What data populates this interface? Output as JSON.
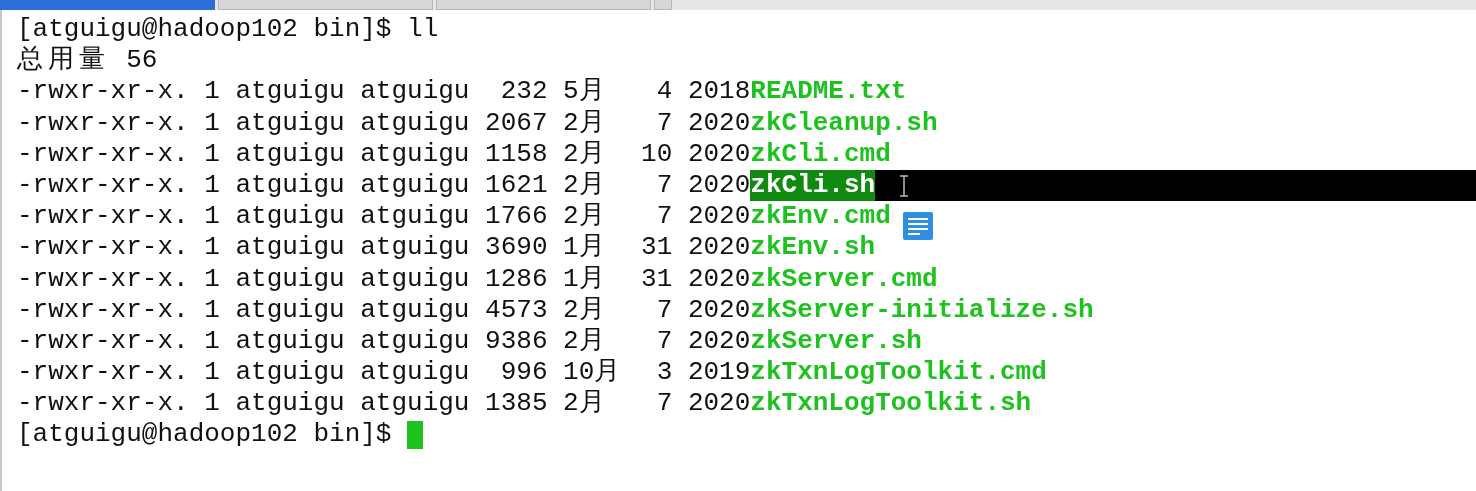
{
  "tabs": [
    {
      "selected": true
    },
    {
      "selected": false
    },
    {
      "selected": false
    },
    {
      "selected": false
    }
  ],
  "terminal": {
    "lines": [
      {
        "kind": "prompt",
        "text": "[atguigu@hadoop102 bin]$ ll"
      },
      {
        "kind": "text",
        "text": "总用量 56"
      },
      {
        "kind": "file",
        "info": "-rwxr-xr-x. 1 atguigu atguigu  232 5月   4 2018",
        "name": "README.txt",
        "selected": false
      },
      {
        "kind": "file",
        "info": "-rwxr-xr-x. 1 atguigu atguigu 2067 2月   7 2020",
        "name": "zkCleanup.sh",
        "selected": false
      },
      {
        "kind": "file",
        "info": "-rwxr-xr-x. 1 atguigu atguigu 1158 2月  10 2020",
        "name": "zkCli.cmd",
        "selected": false
      },
      {
        "kind": "file",
        "info": "-rwxr-xr-x. 1 atguigu atguigu 1621 2月   7 2020",
        "name": "zkCli.sh",
        "selected": true
      },
      {
        "kind": "file",
        "info": "-rwxr-xr-x. 1 atguigu atguigu 1766 2月   7 2020",
        "name": "zkEnv.cmd",
        "selected": false
      },
      {
        "kind": "file",
        "info": "-rwxr-xr-x. 1 atguigu atguigu 3690 1月  31 2020",
        "name": "zkEnv.sh",
        "selected": false
      },
      {
        "kind": "file",
        "info": "-rwxr-xr-x. 1 atguigu atguigu 1286 1月  31 2020",
        "name": "zkServer.cmd",
        "selected": false
      },
      {
        "kind": "file",
        "info": "-rwxr-xr-x. 1 atguigu atguigu 4573 2月   7 2020",
        "name": "zkServer-initialize.sh",
        "selected": false
      },
      {
        "kind": "file",
        "info": "-rwxr-xr-x. 1 atguigu atguigu 9386 2月   7 2020",
        "name": "zkServer.sh",
        "selected": false
      },
      {
        "kind": "file",
        "info": "-rwxr-xr-x. 1 atguigu atguigu  996 10月  3 2019",
        "name": "zkTxnLogToolkit.cmd",
        "selected": false
      },
      {
        "kind": "file",
        "info": "-rwxr-xr-x. 1 atguigu atguigu 1385 2月   7 2020",
        "name": "zkTxnLogToolkit.sh",
        "selected": false
      },
      {
        "kind": "prompt",
        "text": "[atguigu@hadoop102 bin]$ ",
        "cursor": true
      }
    ]
  }
}
